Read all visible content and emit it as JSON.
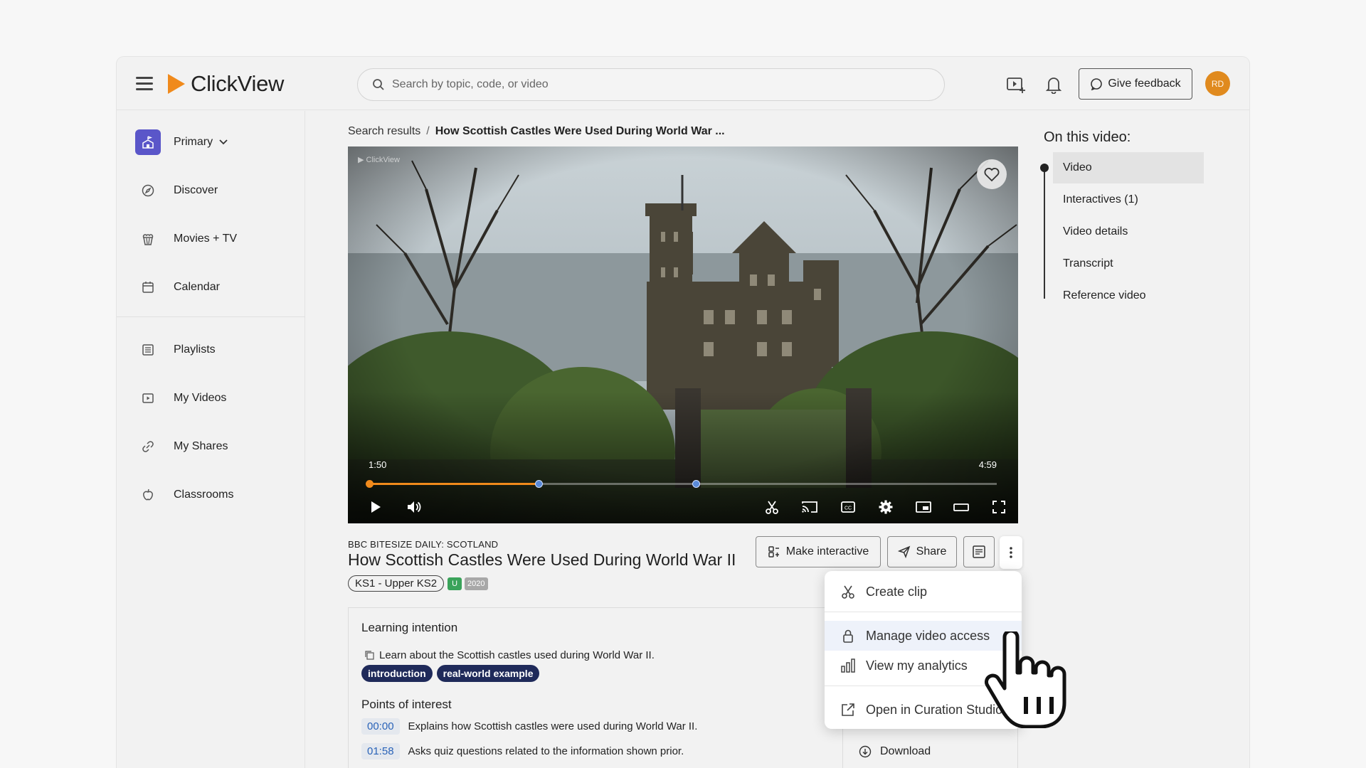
{
  "header": {
    "logo_text": "ClickView",
    "search_placeholder": "Search by topic, code, or video",
    "feedback_label": "Give feedback",
    "avatar_initials": "RD"
  },
  "sidebar": {
    "items": [
      {
        "label": "Primary",
        "icon": "school-icon"
      },
      {
        "label": "Discover",
        "icon": "compass-icon"
      },
      {
        "label": "Movies + TV",
        "icon": "popcorn-icon"
      },
      {
        "label": "Calendar",
        "icon": "calendar-icon"
      },
      {
        "label": "Playlists",
        "icon": "list-icon"
      },
      {
        "label": "My Videos",
        "icon": "video-icon"
      },
      {
        "label": "My Shares",
        "icon": "link-icon"
      },
      {
        "label": "Classrooms",
        "icon": "apple-icon"
      }
    ]
  },
  "breadcrumb": {
    "parent": "Search results",
    "separator": "/",
    "current": "How Scottish Castles Were Used During World War ..."
  },
  "video": {
    "watermark": "ClickView",
    "current_time": "1:50",
    "total_time": "4:59",
    "progress": 0.27,
    "markers": [
      0.0,
      0.27,
      0.52
    ]
  },
  "details": {
    "source": "BBC BITESIZE DAILY: SCOTLAND",
    "title": "How Scottish Castles Were Used During World War II",
    "level": "KS1 - Upper KS2",
    "rating": "U",
    "year": "2020"
  },
  "actions": {
    "make_interactive": "Make interactive",
    "share": "Share"
  },
  "panel": {
    "learning_heading": "Learning intention",
    "learning_text": "Learn about the Scottish castles used during World War II.",
    "chips": [
      "introduction",
      "real-world example"
    ],
    "poi_heading": "Points of interest",
    "poi": [
      {
        "time": "00:00",
        "text": "Explains how Scottish castles were used during World War II."
      },
      {
        "time": "01:58",
        "text": "Asks quiz questions related to the information shown prior."
      }
    ]
  },
  "under_menu": {
    "download": "Download"
  },
  "toc": {
    "title": "On this video:",
    "items": [
      "Video",
      "Interactives (1)",
      "Video details",
      "Transcript",
      "Reference video"
    ]
  },
  "menu": {
    "create_clip": "Create clip",
    "manage_access": "Manage video access",
    "analytics": "View my analytics",
    "curation": "Open in Curation Studio"
  },
  "colors": {
    "brand": "#f08a1c",
    "chip": "#1f2a5a",
    "sidebar_primary": "#5a56c9"
  }
}
